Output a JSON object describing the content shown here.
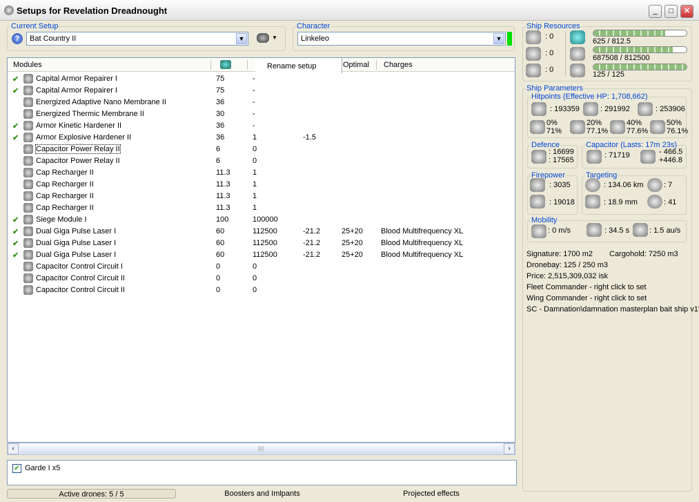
{
  "window": {
    "title": "Setups for Revelation Dreadnought",
    "buttons": [
      "_",
      "□",
      "✕"
    ]
  },
  "setup": {
    "legend": "Current Setup",
    "value": "Bat Country II"
  },
  "character": {
    "legend": "Character",
    "value": "Linkeleo",
    "status_color": "#00e000"
  },
  "context_menu": {
    "item": "Rename setup"
  },
  "table": {
    "headers": {
      "modules": "Modules",
      "optimal": "Optimal",
      "charges": "Charges"
    },
    "rows": [
      {
        "active": true,
        "name": "Capital Armor Repairer I",
        "cpu": "75",
        "power": "-",
        "cap": "",
        "optimal": "",
        "charges": ""
      },
      {
        "active": true,
        "name": "Capital Armor Repairer I",
        "cpu": "75",
        "power": "-",
        "cap": "",
        "optimal": "",
        "charges": ""
      },
      {
        "active": false,
        "name": "Energized Adaptive Nano Membrane II",
        "cpu": "36",
        "power": "-",
        "cap": "",
        "optimal": "",
        "charges": ""
      },
      {
        "active": false,
        "name": "Energized Thermic Membrane II",
        "cpu": "30",
        "power": "-",
        "cap": "",
        "optimal": "",
        "charges": ""
      },
      {
        "active": true,
        "name": "Armor Kinetic Hardener II",
        "cpu": "36",
        "power": "-",
        "cap": "",
        "optimal": "",
        "charges": ""
      },
      {
        "active": true,
        "name": "Armor Explosive Hardener II",
        "cpu": "36",
        "power": "1",
        "cap": "-1.5",
        "optimal": "",
        "charges": ""
      },
      {
        "active": false,
        "name": "Capacitor Power Relay II",
        "cpu": "6",
        "power": "0",
        "cap": "",
        "optimal": "",
        "charges": "",
        "focused": true
      },
      {
        "active": false,
        "name": "Capacitor Power Relay II",
        "cpu": "6",
        "power": "0",
        "cap": "",
        "optimal": "",
        "charges": ""
      },
      {
        "active": false,
        "name": "Cap Recharger II",
        "cpu": "11.3",
        "power": "1",
        "cap": "",
        "optimal": "",
        "charges": ""
      },
      {
        "active": false,
        "name": "Cap Recharger II",
        "cpu": "11.3",
        "power": "1",
        "cap": "",
        "optimal": "",
        "charges": ""
      },
      {
        "active": false,
        "name": "Cap Recharger II",
        "cpu": "11.3",
        "power": "1",
        "cap": "",
        "optimal": "",
        "charges": ""
      },
      {
        "active": false,
        "name": "Cap Recharger II",
        "cpu": "11.3",
        "power": "1",
        "cap": "",
        "optimal": "",
        "charges": ""
      },
      {
        "active": true,
        "name": "Siege Module I",
        "cpu": "100",
        "power": "100000",
        "cap": "",
        "optimal": "",
        "charges": ""
      },
      {
        "active": true,
        "name": "Dual Giga Pulse Laser I",
        "cpu": "60",
        "power": "112500",
        "cap": "-21.2",
        "optimal": "25+20",
        "charges": "Blood Multifrequency XL"
      },
      {
        "active": true,
        "name": "Dual Giga Pulse Laser I",
        "cpu": "60",
        "power": "112500",
        "cap": "-21.2",
        "optimal": "25+20",
        "charges": "Blood Multifrequency XL"
      },
      {
        "active": true,
        "name": "Dual Giga Pulse Laser I",
        "cpu": "60",
        "power": "112500",
        "cap": "-21.2",
        "optimal": "25+20",
        "charges": "Blood Multifrequency XL"
      },
      {
        "active": false,
        "name": "Capacitor Control Circuit I",
        "cpu": "0",
        "power": "0",
        "cap": "",
        "optimal": "",
        "charges": ""
      },
      {
        "active": false,
        "name": "Capacitor Control Circuit II",
        "cpu": "0",
        "power": "0",
        "cap": "",
        "optimal": "",
        "charges": ""
      },
      {
        "active": false,
        "name": "Capacitor Control Circuit II",
        "cpu": "0",
        "power": "0",
        "cap": "",
        "optimal": "",
        "charges": ""
      }
    ]
  },
  "drones": {
    "item": "Garde I x5",
    "checked": true
  },
  "bottom_tabs": [
    "Active drones: 5 / 5",
    "Boosters and Imlpants",
    "Projected effects"
  ],
  "resources": {
    "legend": "Ship Resources",
    "hardpoints": [
      ": 0",
      ": 0",
      ": 0"
    ],
    "cpu": {
      "text": "625 / 812.5",
      "fraction": 0.77
    },
    "power": {
      "text": "687508 / 812500",
      "fraction": 0.85
    },
    "calibration": {
      "text": "125 / 125",
      "fraction": 1.0
    }
  },
  "params": {
    "legend": "Ship Parameters",
    "hitpoints": {
      "legend": "Hitpoints (Effective HP: 1,708,662)",
      "shield": ": 193359",
      "armor": ": 291992",
      "structure": ": 253906",
      "resists": [
        {
          "a": "0%",
          "b": "71%"
        },
        {
          "a": "20%",
          "b": "77.1%"
        },
        {
          "a": "40%",
          "b": "77.6%"
        },
        {
          "a": "50%",
          "b": "76.1%"
        }
      ]
    },
    "defence": {
      "legend": "Defence",
      "a": ": 16699",
      "b": ": 17565"
    },
    "capacitor": {
      "legend": "Capacitor (Lasts: 17m 23s)",
      "amount": ": 71719",
      "use": "- 466.5",
      "recharge": "+446.8"
    },
    "firepower": {
      "legend": "Firepower",
      "dps": ": 3035",
      "volley": ": 19018"
    },
    "targeting": {
      "legend": "Targeting",
      "range": ": 134.06 km",
      "targets": ": 7",
      "scan": ": 18.9 mm",
      "sensor": ": 41"
    },
    "mobility": {
      "legend": "Mobility",
      "speed": ": 0 m/s",
      "align": ": 34.5 s",
      "warp": ": 1.5 au/s"
    },
    "info": {
      "signature": "Signature: 1700 m2",
      "cargo": "Cargohold: 7250 m3",
      "dronebay": "Dronebay: 125 / 250 m3",
      "price": "Price: 2,515,309,032 isk",
      "fleet": "Fleet Commander - right click to set",
      "wing": "Wing Commander - right click to set",
      "sc": "SC - Damnation\\damnation masterplan bait ship v1'"
    }
  }
}
